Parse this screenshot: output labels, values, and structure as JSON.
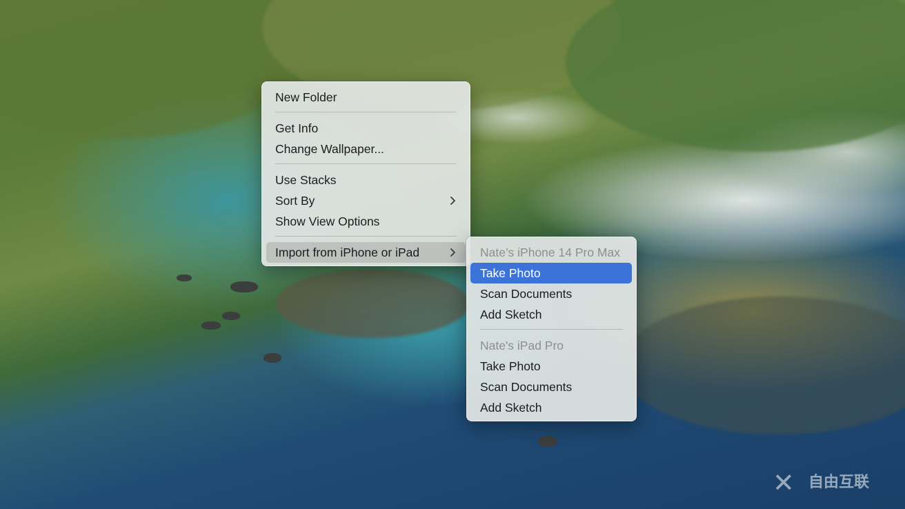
{
  "wallpaper": {
    "scene": "big-sur-coastline"
  },
  "context_menu": {
    "items": [
      {
        "label": "New Folder"
      },
      {
        "label": "Get Info"
      },
      {
        "label": "Change Wallpaper..."
      },
      {
        "label": "Use Stacks"
      },
      {
        "label": "Sort By",
        "submenu_icon": "chevron-right-icon"
      },
      {
        "label": "Show View Options"
      },
      {
        "label": "Import from iPhone or iPad",
        "submenu_icon": "chevron-right-icon",
        "state": "open"
      }
    ]
  },
  "import_submenu": {
    "groups": [
      {
        "device": "Nate’s iPhone 14 Pro Max",
        "items": [
          {
            "label": "Take Photo",
            "state": "selected"
          },
          {
            "label": "Scan Documents"
          },
          {
            "label": "Add Sketch"
          }
        ]
      },
      {
        "device": "Nate's iPad Pro",
        "items": [
          {
            "label": "Take Photo"
          },
          {
            "label": "Scan Documents"
          },
          {
            "label": "Add Sketch"
          }
        ]
      }
    ]
  },
  "watermark": {
    "text": "自由互联",
    "logo_icon": "x-logo-icon"
  },
  "colors": {
    "selection": "#3b73d9",
    "menu_background": "#e2e6e4",
    "disabled_text": "#8e8e90"
  }
}
